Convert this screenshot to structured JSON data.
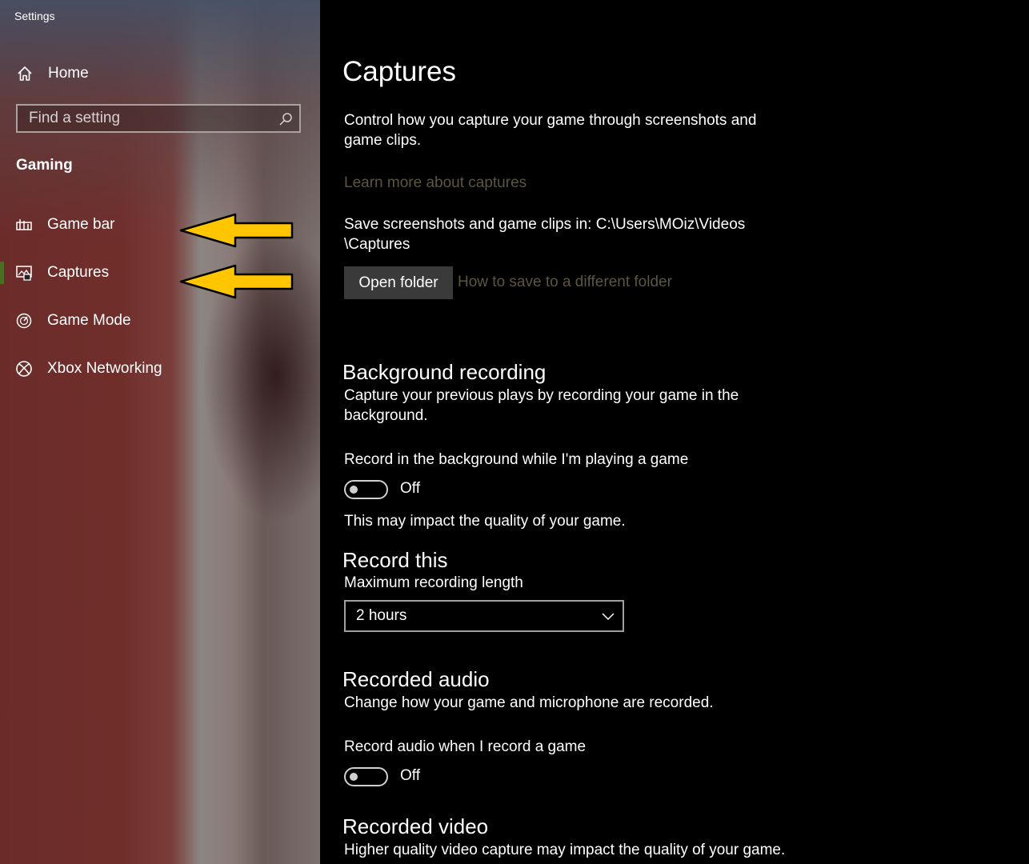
{
  "window": {
    "title": "Settings"
  },
  "sidebar": {
    "home_label": "Home",
    "search_placeholder": "Find a setting",
    "section_label": "Gaming",
    "items": [
      {
        "label": "Game bar",
        "icon": "game-bar-icon"
      },
      {
        "label": "Captures",
        "icon": "captures-icon",
        "selected": true
      },
      {
        "label": "Game Mode",
        "icon": "game-mode-icon"
      },
      {
        "label": "Xbox Networking",
        "icon": "xbox-icon"
      }
    ],
    "annotation_color": "#ffc600"
  },
  "main": {
    "title": "Captures",
    "description": "Control how you capture your game through screenshots and game clips.",
    "learn_more_link": "Learn more about captures",
    "save_location_line1": "Save screenshots and game clips in: C:\\Users\\MOiz\\Videos",
    "save_location_line2": "\\Captures",
    "open_folder_button": "Open folder",
    "different_folder_link": "How to save to a different folder",
    "background_recording": {
      "heading": "Background recording",
      "description": "Capture your previous plays by recording your game in the background.",
      "toggle_label": "Record in the background while I'm playing a game",
      "toggle_state": "Off",
      "note": "This may impact the quality of your game."
    },
    "record_this": {
      "heading": "Record this",
      "max_length_label": "Maximum recording length",
      "max_length_value": "2 hours"
    },
    "recorded_audio": {
      "heading": "Recorded audio",
      "description": "Change how your game and microphone are recorded.",
      "toggle_label": "Record audio when I record a game",
      "toggle_state": "Off"
    },
    "recorded_video": {
      "heading": "Recorded video",
      "description": "Higher quality video capture may impact the quality of your game."
    }
  }
}
